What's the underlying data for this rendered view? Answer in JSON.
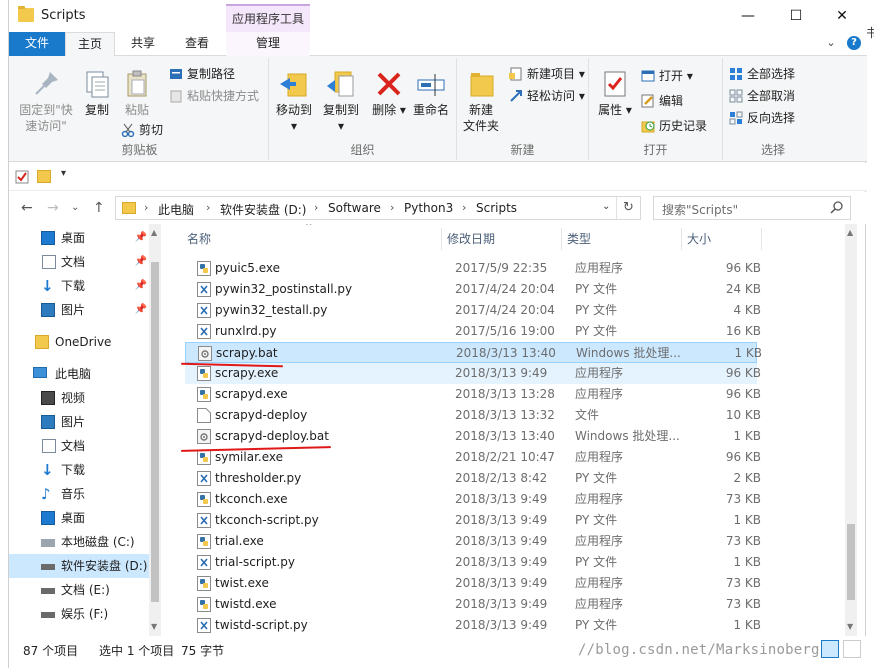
{
  "window": {
    "title": "Scripts",
    "contextual_tab": "应用程序工具"
  },
  "titlebar_buttons": {
    "minimize": "—",
    "maximize": "☐",
    "close": "✕"
  },
  "tabs": [
    "文件",
    "主页",
    "共享",
    "查看",
    "管理"
  ],
  "ribbon": {
    "clipboard": {
      "label": "剪贴板",
      "pin": "固定到\"快\n速访问\"",
      "copy": "复制",
      "paste": "粘贴",
      "copy_path": "复制路径",
      "paste_shortcut": "粘贴快捷方式",
      "cut": "剪切"
    },
    "organize": {
      "label": "组织",
      "move_to": "移动到",
      "copy_to": "复制到",
      "delete": "删除",
      "rename": "重命名"
    },
    "new": {
      "label": "新建",
      "new_folder": "新建\n文件夹",
      "new_item": "新建项目",
      "easy_access": "轻松访问"
    },
    "open": {
      "label": "打开",
      "properties": "属性",
      "open": "打开",
      "edit": "编辑",
      "history": "历史记录"
    },
    "select": {
      "label": "选择",
      "select_all": "全部选择",
      "select_none": "全部取消",
      "invert": "反向选择"
    }
  },
  "address": {
    "crumbs": [
      "此电脑",
      "软件安装盘 (D:)",
      "Software",
      "Python3",
      "Scripts"
    ],
    "search_placeholder": "搜索\"Scripts\""
  },
  "nav": [
    {
      "label": "桌面",
      "pinned": true
    },
    {
      "label": "文档",
      "pinned": true
    },
    {
      "label": "下载",
      "pinned": true
    },
    {
      "label": "图片",
      "pinned": true
    },
    {
      "label": "OneDrive"
    },
    {
      "label": "此电脑"
    },
    {
      "label": "视频"
    },
    {
      "label": "图片"
    },
    {
      "label": "文档"
    },
    {
      "label": "下载"
    },
    {
      "label": "音乐"
    },
    {
      "label": "桌面"
    },
    {
      "label": "本地磁盘 (C:)"
    },
    {
      "label": "软件安装盘 (D:)",
      "selected": true
    },
    {
      "label": "文档 (E:)"
    },
    {
      "label": "娱乐 (F:)"
    }
  ],
  "columns": {
    "name": "名称",
    "date": "修改日期",
    "type": "类型",
    "size": "大小"
  },
  "files": [
    {
      "name": "pyuic5.exe",
      "date": "2017/5/9 22:35",
      "type": "应用程序",
      "size": "96 KB",
      "icon": "exe"
    },
    {
      "name": "pywin32_postinstall.py",
      "date": "2017/4/24 20:04",
      "type": "PY 文件",
      "size": "24 KB",
      "icon": "py"
    },
    {
      "name": "pywin32_testall.py",
      "date": "2017/4/24 20:04",
      "type": "PY 文件",
      "size": "4 KB",
      "icon": "py"
    },
    {
      "name": "runxlrd.py",
      "date": "2017/5/16 19:00",
      "type": "PY 文件",
      "size": "16 KB",
      "icon": "py"
    },
    {
      "name": "scrapy.bat",
      "date": "2018/3/13 13:40",
      "type": "Windows 批处理...",
      "size": "1 KB",
      "icon": "bat",
      "state": "selected"
    },
    {
      "name": "scrapy.exe",
      "date": "2018/3/13 9:49",
      "type": "应用程序",
      "size": "96 KB",
      "icon": "exe",
      "state": "hover"
    },
    {
      "name": "scrapyd.exe",
      "date": "2018/3/13 13:28",
      "type": "应用程序",
      "size": "96 KB",
      "icon": "exe"
    },
    {
      "name": "scrapyd-deploy",
      "date": "2018/3/13 13:32",
      "type": "文件",
      "size": "10 KB",
      "icon": "blank"
    },
    {
      "name": "scrapyd-deploy.bat",
      "date": "2018/3/13 13:40",
      "type": "Windows 批处理...",
      "size": "1 KB",
      "icon": "bat"
    },
    {
      "name": "symilar.exe",
      "date": "2018/2/21 10:47",
      "type": "应用程序",
      "size": "96 KB",
      "icon": "exe"
    },
    {
      "name": "thresholder.py",
      "date": "2018/2/13 8:42",
      "type": "PY 文件",
      "size": "2 KB",
      "icon": "py"
    },
    {
      "name": "tkconch.exe",
      "date": "2018/3/13 9:49",
      "type": "应用程序",
      "size": "73 KB",
      "icon": "exe"
    },
    {
      "name": "tkconch-script.py",
      "date": "2018/3/13 9:49",
      "type": "PY 文件",
      "size": "1 KB",
      "icon": "py"
    },
    {
      "name": "trial.exe",
      "date": "2018/3/13 9:49",
      "type": "应用程序",
      "size": "73 KB",
      "icon": "exe"
    },
    {
      "name": "trial-script.py",
      "date": "2018/3/13 9:49",
      "type": "PY 文件",
      "size": "1 KB",
      "icon": "py"
    },
    {
      "name": "twist.exe",
      "date": "2018/3/13 9:49",
      "type": "应用程序",
      "size": "73 KB",
      "icon": "exe"
    },
    {
      "name": "twistd.exe",
      "date": "2018/3/13 9:49",
      "type": "应用程序",
      "size": "73 KB",
      "icon": "exe"
    },
    {
      "name": "twistd-script.py",
      "date": "2018/3/13 9:49",
      "type": "PY 文件",
      "size": "1 KB",
      "icon": "py"
    }
  ],
  "status": {
    "count": "87 个项目",
    "selection": "选中 1 个项目",
    "size": "75 字节"
  },
  "watermark": "//blog.csdn.net/Marksinoberg",
  "colors": {
    "accent": "#1979ca",
    "selected_row": "#cce8ff",
    "annotation": "#e01818"
  }
}
